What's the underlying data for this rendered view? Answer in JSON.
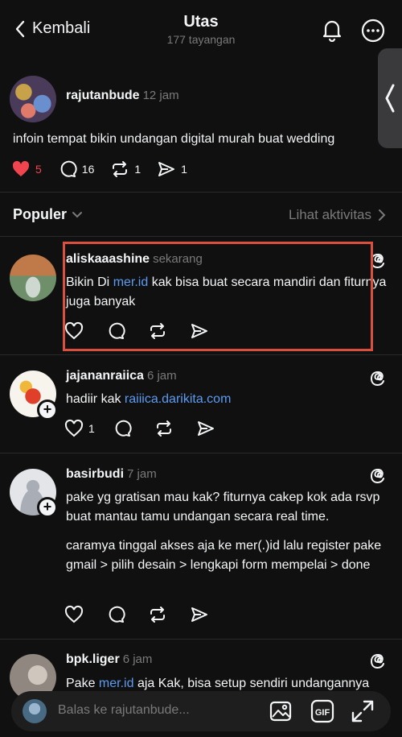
{
  "header": {
    "back_label": "Kembali",
    "title": "Utas",
    "subtitle": "177 tayangan",
    "icons": [
      "chevron-left-icon",
      "bell-icon",
      "more-icon"
    ]
  },
  "main_post": {
    "username": "rajutanbude",
    "time": "12 jam",
    "text": "infoin tempat bikin undangan digital murah buat wedding",
    "likes": "5",
    "comments": "16",
    "reposts": "1",
    "shares": "1"
  },
  "sort": {
    "label": "Populer",
    "activity_label": "Lihat aktivitas"
  },
  "replies": [
    {
      "username": "aliskaaashine",
      "time": "sekarang",
      "text_before": "Bikin Di ",
      "link": "mer.id",
      "text_after": " kak bisa buat secara mandiri dan fiturnya juga banyak"
    },
    {
      "username": "jajananraiica",
      "time": "6 jam",
      "text_before": "hadiir kak ",
      "link": "raiiica.darikita.com",
      "likes": "1"
    },
    {
      "username": "basirbudi",
      "time": "7 jam",
      "paragraph1": "pake yg gratisan mau kak? fiturnya cakep kok ada rsvp buat mantau tamu undangan secara real time.",
      "paragraph2": "caramya tinggal akses aja ke mer(.)id lalu register pake gmail > pilih desain > lengkapi form mempelai > done"
    },
    {
      "username": "bpk.liger",
      "time": "6 jam",
      "text_before": "Pake ",
      "link": "mer.id",
      "text_after": " aja Kak, bisa setup sendiri undangannya"
    }
  ],
  "compose": {
    "placeholder": "Balas ke rajutanbude..."
  },
  "colors": {
    "background": "#101010",
    "heart": "#f0454f",
    "link": "#5b9bf2",
    "highlight": "#d9503f"
  }
}
